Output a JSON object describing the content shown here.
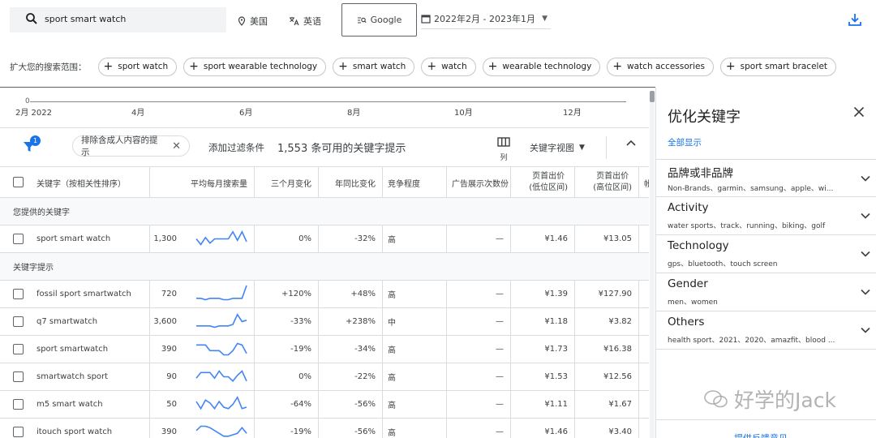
{
  "search": {
    "query": "sport smart watch"
  },
  "location": "美国",
  "language": "英语",
  "network": "Google",
  "date_range": "2022年2月 - 2023年1月",
  "expand": {
    "label": "扩大您的搜索范围：",
    "chips": [
      "sport watch",
      "sport wearable technology",
      "smart watch",
      "watch",
      "wearable technology",
      "watch accessories",
      "sport smart bracelet"
    ]
  },
  "timeline": {
    "zero": "0",
    "ticks": [
      "2月 2022",
      "4月",
      "6月",
      "8月",
      "10月",
      "12月"
    ]
  },
  "toolbar": {
    "filter_count": "1",
    "adult_chip": "排除含成人内容的提示",
    "add_filter": "添加过滤条件",
    "count_text": "1,553 条可用的关键字提示",
    "columns_label": "列",
    "view_label": "关键字视图"
  },
  "table": {
    "headers": {
      "keyword": "关键字（按相关性排序）",
      "avg_searches": "平均每月搜索量",
      "three_month": "三个月变化",
      "yoy": "年同比变化",
      "competition": "竞争程度",
      "ad_share": "广告展示次数份",
      "bid_low_1": "页首出价",
      "bid_low_2": "(低位区间)",
      "bid_high_1": "页首出价",
      "bid_high_2": "(高位区间)",
      "account": "帐"
    },
    "section_provided": "您提供的关键字",
    "section_suggestions": "关键字提示",
    "provided": [
      {
        "keyword": "sport smart watch",
        "avg": "1,300",
        "spark": [
          6,
          2,
          7,
          3,
          6,
          6,
          6,
          6,
          11,
          5,
          11,
          4
        ],
        "three_month": "0%",
        "yoy": "-32%",
        "competition": "高",
        "share": "—",
        "bid_low": "¥1.46",
        "bid_high": "¥13.05"
      }
    ],
    "suggestions": [
      {
        "keyword": "fossil sport smartwatch",
        "avg": "720",
        "spark": [
          3,
          3,
          2,
          3,
          3,
          3,
          2,
          2,
          3,
          3,
          3,
          12
        ],
        "three_month": "+120%",
        "yoy": "+48%",
        "competition": "高",
        "share": "—",
        "bid_low": "¥1.39",
        "bid_high": "¥127.90"
      },
      {
        "keyword": "q7 smartwatch",
        "avg": "3,600",
        "spark": [
          3,
          3,
          3,
          3,
          2,
          3,
          3,
          3,
          4,
          11,
          6,
          7
        ],
        "three_month": "-33%",
        "yoy": "+238%",
        "competition": "中",
        "share": "—",
        "bid_low": "¥1.18",
        "bid_high": "¥3.82"
      },
      {
        "keyword": "sport smartwatch",
        "avg": "390",
        "spark": [
          9,
          9,
          9,
          5,
          5,
          5,
          2,
          2,
          5,
          10,
          9,
          3
        ],
        "three_month": "-19%",
        "yoy": "-34%",
        "competition": "高",
        "share": "—",
        "bid_low": "¥1.73",
        "bid_high": "¥16.38"
      },
      {
        "keyword": "smartwatch sport",
        "avg": "90",
        "spark": [
          5,
          9,
          9,
          9,
          5,
          10,
          6,
          6,
          3,
          7,
          10,
          3
        ],
        "three_month": "0%",
        "yoy": "-22%",
        "competition": "高",
        "share": "—",
        "bid_low": "¥1.53",
        "bid_high": "¥12.56"
      },
      {
        "keyword": "m5 smart watch",
        "avg": "50",
        "spark": [
          8,
          3,
          9,
          7,
          3,
          8,
          4,
          3,
          6,
          11,
          3,
          4
        ],
        "three_month": "-64%",
        "yoy": "-56%",
        "competition": "高",
        "share": "—",
        "bid_low": "¥1.11",
        "bid_high": "¥1.67"
      },
      {
        "keyword": "itouch sport watch",
        "avg": "390",
        "spark": [
          7,
          10,
          10,
          9,
          7,
          5,
          3,
          3,
          4,
          5,
          9,
          5
        ],
        "three_month": "-19%",
        "yoy": "-56%",
        "competition": "高",
        "share": "—",
        "bid_low": "¥1.46",
        "bid_high": "¥3.40"
      }
    ]
  },
  "panel": {
    "title": "优化关键字",
    "show_all": "全部显示",
    "groups": [
      {
        "name": "品牌或非品牌",
        "sub": "Non-Brands、garmin、samsung、apple、wi..."
      },
      {
        "name": "Activity",
        "sub": "water sports、track、running、biking、golf"
      },
      {
        "name": "Technology",
        "sub": "gps、bluetooth、touch screen"
      },
      {
        "name": "Gender",
        "sub": "men、women"
      },
      {
        "name": "Others",
        "sub": "health sport、2021、2020、amazfit、blood ..."
      }
    ],
    "feedback": "提供反馈意见"
  },
  "watermark": "好学的Jack",
  "colors": {
    "accent": "#1a73e8",
    "spark": "#4285f4"
  }
}
